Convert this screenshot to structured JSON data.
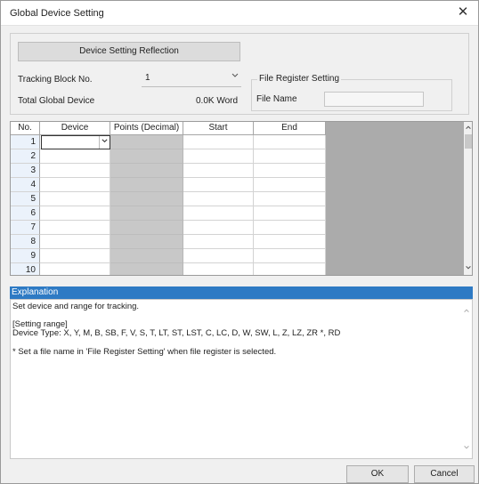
{
  "window": {
    "title": "Global Device Setting",
    "close_glyph": "✕"
  },
  "settings": {
    "reflect_button": "Device Setting Reflection",
    "tracking_label": "Tracking Block No.",
    "tracking_value": "1",
    "total_label": "Total Global Device",
    "total_value": "0.0K Word",
    "file_register_group": "File Register Setting",
    "file_name_label": "File Name",
    "file_name_value": ""
  },
  "grid": {
    "headers": {
      "no": "No.",
      "device": "Device",
      "points": "Points (Decimal)",
      "start": "Start",
      "end": "End"
    },
    "rows": [
      {
        "no": "1"
      },
      {
        "no": "2"
      },
      {
        "no": "3"
      },
      {
        "no": "4"
      },
      {
        "no": "5"
      },
      {
        "no": "6"
      },
      {
        "no": "7"
      },
      {
        "no": "8"
      },
      {
        "no": "9"
      },
      {
        "no": "10"
      }
    ]
  },
  "explanation": {
    "header": "Explanation",
    "line1": "Set device and range for tracking.",
    "line2": "[Setting range]",
    "line3": "Device Type: X, Y, M, B, SB, F, V, S, T, LT, ST, LST, C, LC, D, W, SW, L, Z, LZ, ZR *, RD",
    "line4": "* Set a file name in 'File Register Setting' when file register is selected."
  },
  "buttons": {
    "ok": "OK",
    "cancel": "Cancel"
  },
  "icons": {
    "close": "close-icon",
    "dropdown": "chevron-down-icon",
    "scroll_up": "scroll-up-icon",
    "scroll_down": "scroll-down-icon"
  },
  "colors": {
    "explanation_header": "#2e7ac4",
    "row_number_bg": "#ebf2fb",
    "disabled_cell": "#c8c8c8",
    "gray_pane": "#ababab"
  }
}
